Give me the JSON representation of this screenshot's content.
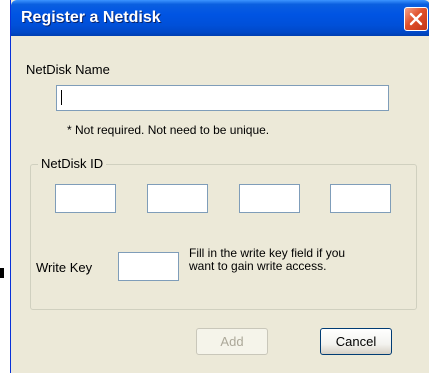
{
  "window": {
    "title": "Register a Netdisk"
  },
  "name_section": {
    "label": "NetDisk Name",
    "value": "",
    "note": "* Not required.  Not need to be unique."
  },
  "id_section": {
    "label": "NetDisk ID",
    "fields": [
      "",
      "",
      "",
      ""
    ]
  },
  "write_key": {
    "label": "Write Key",
    "value": "",
    "hint_line1": "Fill in the write key field if you",
    "hint_line2": "want to gain write access."
  },
  "buttons": {
    "add": "Add",
    "cancel": "Cancel"
  },
  "colors": {
    "titlebar": "#0054e3",
    "dialog_bg": "#ece9d8",
    "close": "#e0502a"
  }
}
